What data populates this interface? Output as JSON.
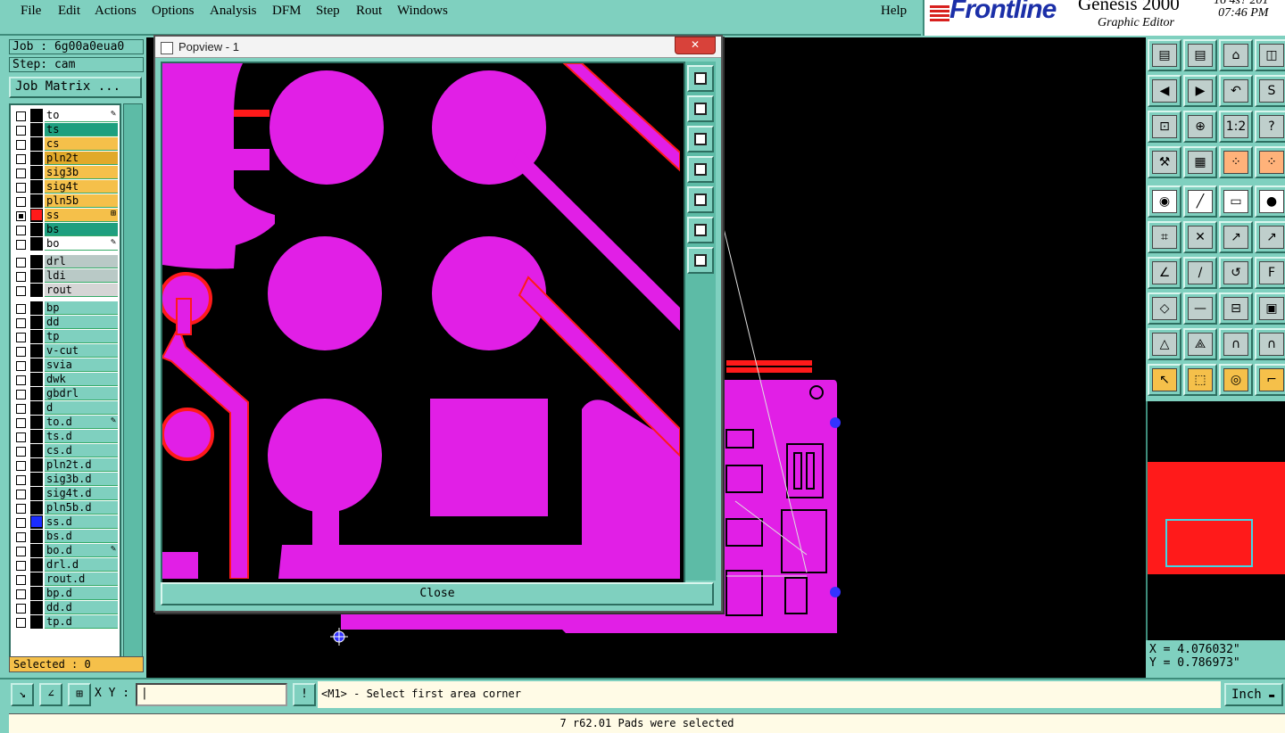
{
  "menu": [
    "File",
    "Edit",
    "Actions",
    "Options",
    "Analysis",
    "DFM",
    "Step",
    "Rout",
    "Windows"
  ],
  "help_label": "Help",
  "branding": {
    "logo_text": "Frontline",
    "product": "Genesis 2000",
    "subtitle": "Graphic Editor",
    "date_partial": "16 4s? 201",
    "time": "07:46 PM"
  },
  "job": {
    "job_label": "Job : 6g00a0eua0",
    "step_label": "Step: cam",
    "matrix_button": "Job Matrix ..."
  },
  "layers": [
    {
      "name": "to",
      "color": "#ffffff",
      "mark": "✎"
    },
    {
      "name": "ts",
      "color": "#1e9f7f"
    },
    {
      "name": "cs",
      "color": "#f5c04a"
    },
    {
      "name": "pln2t",
      "color": "#e1a92a"
    },
    {
      "name": "sig3b",
      "color": "#f5c04a"
    },
    {
      "name": "sig4t",
      "color": "#f5c04a"
    },
    {
      "name": "pln5b",
      "color": "#f5c04a"
    },
    {
      "name": "ss",
      "color": "#f5c04a",
      "mark": "⊞",
      "checked": true,
      "swatch": "#ff1a1a"
    },
    {
      "name": "bs",
      "color": "#1e9f7f"
    },
    {
      "name": "bo",
      "color": "#ffffff",
      "mark": "✎"
    },
    {
      "name": "drl",
      "color": "#b9c9c6",
      "gap": true
    },
    {
      "name": "ldi",
      "color": "#b9c9c6"
    },
    {
      "name": "rout",
      "color": "#d5d5d5"
    },
    {
      "name": "bp",
      "color": "#7fd0bf",
      "gap": true
    },
    {
      "name": "dd",
      "color": "#7fd0bf"
    },
    {
      "name": "tp",
      "color": "#7fd0bf"
    },
    {
      "name": "v-cut",
      "color": "#7fd0bf"
    },
    {
      "name": "svia",
      "color": "#7fd0bf"
    },
    {
      "name": "dwk",
      "color": "#7fd0bf"
    },
    {
      "name": "gbdrl",
      "color": "#7fd0bf"
    },
    {
      "name": "d",
      "color": "#7fd0bf"
    },
    {
      "name": "to.d",
      "color": "#7fd0bf",
      "mark": "✎"
    },
    {
      "name": "ts.d",
      "color": "#7fd0bf"
    },
    {
      "name": "cs.d",
      "color": "#7fd0bf"
    },
    {
      "name": "pln2t.d",
      "color": "#7fd0bf"
    },
    {
      "name": "sig3b.d",
      "color": "#7fd0bf"
    },
    {
      "name": "sig4t.d",
      "color": "#7fd0bf"
    },
    {
      "name": "pln5b.d",
      "color": "#7fd0bf"
    },
    {
      "name": "ss.d",
      "color": "#7fd0bf",
      "swatch": "#1a2cff"
    },
    {
      "name": "bs.d",
      "color": "#7fd0bf"
    },
    {
      "name": "bo.d",
      "color": "#7fd0bf",
      "mark": "✎"
    },
    {
      "name": "drl.d",
      "color": "#7fd0bf"
    },
    {
      "name": "rout.d",
      "color": "#7fd0bf"
    },
    {
      "name": "bp.d",
      "color": "#7fd0bf"
    },
    {
      "name": "dd.d",
      "color": "#7fd0bf"
    },
    {
      "name": "tp.d",
      "color": "#7fd0bf"
    }
  ],
  "selected_label": "Selected : 0",
  "popview": {
    "title": "Popview - 1",
    "close_button": "Close",
    "close_x": "✕"
  },
  "xy": {
    "label": "X Y :",
    "input_value": "",
    "input_caret": "|"
  },
  "prompt": "<M1> - Select first area corner",
  "units": "Inch",
  "status": "7 r62.01 Pads were selected",
  "coordinates": {
    "x": "X = 4.076032\"",
    "y": "Y = 0.786973\""
  },
  "colors": {
    "panel": "#7fd0bf",
    "copper": "#e11fe6",
    "highlight": "#ff1a1a",
    "accent": "#f5c04a"
  }
}
